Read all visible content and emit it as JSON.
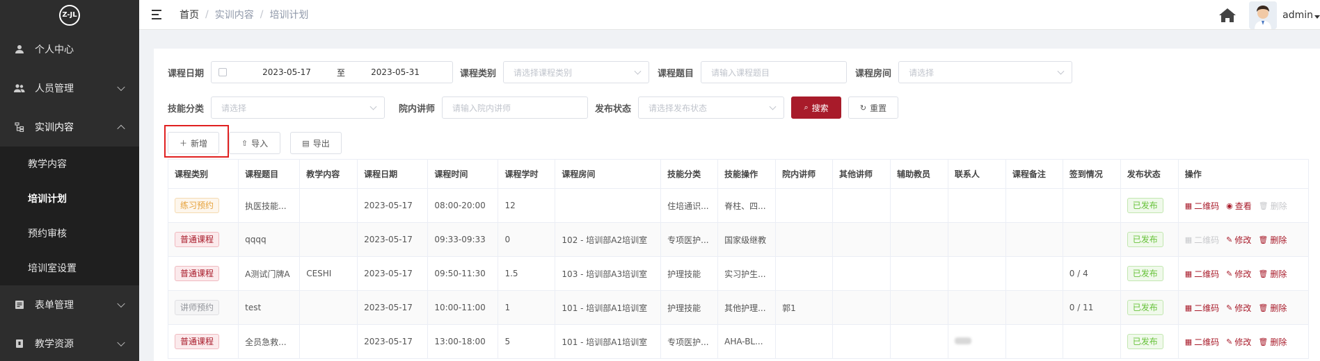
{
  "sidebar": {
    "logo": "Z-JL",
    "items": [
      {
        "label": "个人中心",
        "icon": "user-icon"
      },
      {
        "label": "人员管理",
        "icon": "users-icon"
      },
      {
        "label": "实训内容",
        "icon": "tree-icon"
      },
      {
        "label": "表单管理",
        "icon": "form-icon"
      },
      {
        "label": "教学资源",
        "icon": "resource-icon"
      }
    ],
    "submenu": [
      {
        "label": "教学内容"
      },
      {
        "label": "培训计划"
      },
      {
        "label": "预约审核"
      },
      {
        "label": "培训室设置"
      }
    ]
  },
  "header": {
    "breadcrumb": [
      "首页",
      "实训内容",
      "培训计划"
    ],
    "separator": "/",
    "username": "admin"
  },
  "filters": {
    "course_date_label": "课程日期",
    "date_start": "2023-05-17",
    "date_to": "至",
    "date_end": "2023-05-31",
    "course_type_label": "课程类别",
    "course_type_placeholder": "请选择课程类别",
    "course_topic_label": "课程题目",
    "course_topic_placeholder": "请输入课程题目",
    "course_room_label": "课程房间",
    "course_room_placeholder": "请选择",
    "skill_category_label": "技能分类",
    "skill_category_placeholder": "请选择",
    "lecturer_label": "院内讲师",
    "lecturer_placeholder": "请输入院内讲师",
    "publish_status_label": "发布状态",
    "publish_status_placeholder": "请选择发布状态",
    "search_label": "搜索",
    "reset_label": "重置"
  },
  "toolbar": {
    "add_label": "新增",
    "import_label": "导入",
    "export_label": "导出"
  },
  "table": {
    "columns": [
      "课程类别",
      "课程题目",
      "教学内容",
      "课程日期",
      "课程时间",
      "课程学时",
      "课程房间",
      "技能分类",
      "技能操作",
      "院内讲师",
      "其他讲师",
      "辅助教员",
      "联系人",
      "课程备注",
      "签到情况",
      "发布状态",
      "操作"
    ],
    "rows": [
      {
        "type": "练习预约",
        "type_color": "orange",
        "topic": "执医技能...",
        "content": "",
        "date": "2023-05-17",
        "time": "08:00-20:00",
        "hours": "12",
        "room": "",
        "skill_cat": "住培通识...",
        "skill_op": "脊柱、四...",
        "lecturer": "",
        "other": "",
        "assist": "",
        "contact": "",
        "remark": "",
        "signin": "",
        "status": "已发布",
        "ops": [
          {
            "label": "二维码",
            "icon": "qrcode-icon",
            "disabled": false
          },
          {
            "label": "查看",
            "icon": "eye-icon",
            "disabled": false
          },
          {
            "label": "删除",
            "icon": "trash-icon",
            "disabled": true
          }
        ]
      },
      {
        "type": "普通课程",
        "type_color": "red",
        "topic": "qqqq",
        "content": "",
        "date": "2023-05-17",
        "time": "09:33-09:33",
        "hours": "0",
        "room": "102 - 培训部A2培训室",
        "skill_cat": "专项医护...",
        "skill_op": "国家级继教",
        "lecturer": "",
        "other": "",
        "assist": "",
        "contact": "",
        "remark": "",
        "signin": "",
        "status": "已发布",
        "ops": [
          {
            "label": "二维码",
            "icon": "qrcode-icon",
            "disabled": true
          },
          {
            "label": "修改",
            "icon": "edit-icon",
            "disabled": false
          },
          {
            "label": "删除",
            "icon": "trash-icon",
            "disabled": false
          }
        ]
      },
      {
        "type": "普通课程",
        "type_color": "red",
        "topic": "A测试门牌A",
        "content": "CESHI",
        "date": "2023-05-17",
        "time": "09:50-11:30",
        "hours": "1.5",
        "room": "103 - 培训部A3培训室",
        "skill_cat": "护理技能",
        "skill_op": "实习护生...",
        "lecturer": "",
        "other": "",
        "assist": "",
        "contact": "",
        "remark": "",
        "signin": "0 / 4",
        "status": "已发布",
        "ops": [
          {
            "label": "二维码",
            "icon": "qrcode-icon",
            "disabled": false
          },
          {
            "label": "修改",
            "icon": "edit-icon",
            "disabled": false
          },
          {
            "label": "删除",
            "icon": "trash-icon",
            "disabled": false
          }
        ]
      },
      {
        "type": "讲师预约",
        "type_color": "gray",
        "topic": "test",
        "content": "",
        "date": "2023-05-17",
        "time": "10:00-11:00",
        "hours": "1",
        "room": "101 - 培训部A1培训室",
        "skill_cat": "护理技能",
        "skill_op": "其他护理...",
        "lecturer": "郭1",
        "other": "",
        "assist": "",
        "contact": "",
        "remark": "",
        "signin": "0 / 11",
        "status": "已发布",
        "ops": [
          {
            "label": "二维码",
            "icon": "qrcode-icon",
            "disabled": false
          },
          {
            "label": "修改",
            "icon": "edit-icon",
            "disabled": false
          },
          {
            "label": "删除",
            "icon": "trash-icon",
            "disabled": false
          }
        ]
      },
      {
        "type": "普通课程",
        "type_color": "red",
        "topic": "全员急救...",
        "content": "",
        "date": "2023-05-17",
        "time": "13:00-18:00",
        "hours": "5",
        "room": "101 - 培训部A1培训室",
        "skill_cat": "专项医护...",
        "skill_op": "AHA-BL...",
        "lecturer": "",
        "other": "",
        "assist": "",
        "contact": "(blurred)",
        "remark": "",
        "signin": "",
        "status": "已发布",
        "ops": [
          {
            "label": "二维码",
            "icon": "qrcode-icon",
            "disabled": false
          },
          {
            "label": "修改",
            "icon": "edit-icon",
            "disabled": false
          },
          {
            "label": "删除",
            "icon": "trash-icon",
            "disabled": false
          }
        ]
      }
    ]
  }
}
